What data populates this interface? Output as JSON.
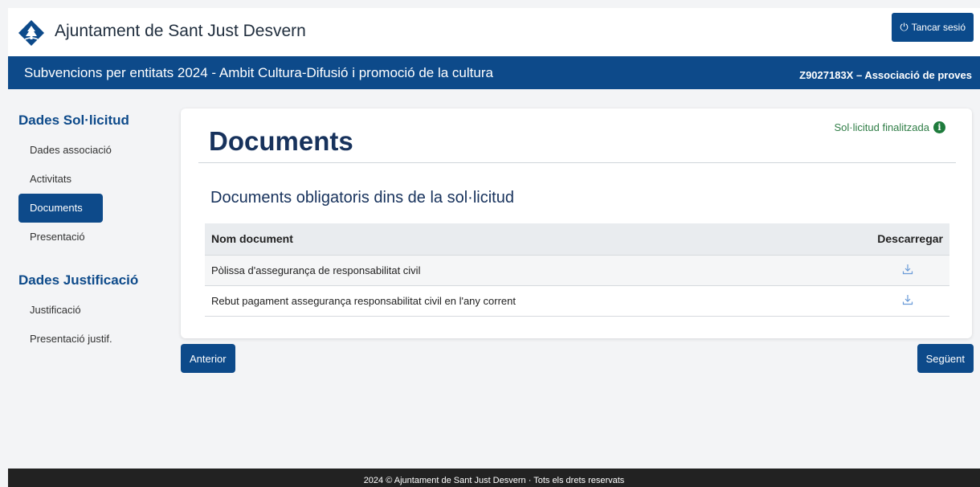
{
  "header": {
    "brand": "Ajuntament de Sant Just Desvern",
    "logout_label": "Tancar sesió"
  },
  "titlebar": {
    "call_title": "Subvencions per entitats 2024 - Ambit Cultura-Difusió i promoció de la cultura",
    "entity": "Z9027183X – Associació de proves"
  },
  "sidebar": {
    "section1": "Dades Sol·licitud",
    "items1": [
      {
        "label": "Dades associació"
      },
      {
        "label": "Activitats"
      },
      {
        "label": "Documents"
      },
      {
        "label": "Presentació"
      }
    ],
    "section2": "Dades Justificació",
    "items2": [
      {
        "label": "Justificació"
      },
      {
        "label": "Presentació justif."
      }
    ]
  },
  "main": {
    "title": "Documents",
    "status": "Sol·licitud finalitzada",
    "status_icon": "info-icon",
    "section_title": "Documents obligatoris dins de la sol·licitud",
    "table": {
      "headers": [
        "Nom document",
        "Descarregar"
      ],
      "rows": [
        {
          "name": "Pòlissa d'assegurança de responsabilitat civil",
          "icon": "download-icon"
        },
        {
          "name": "Rebut pagament assegurança responsabilitat civil en l'any corrent",
          "icon": "download-icon"
        }
      ]
    }
  },
  "nav": {
    "prev_label": "Anterior",
    "next_label": "Següent"
  },
  "footer": {
    "text": "2024 © Ajuntament de Sant Just Desvern · Tots els drets reservats"
  },
  "colors": {
    "primary": "#0d4a8a",
    "status_green": "#2f7d46",
    "download_icon": "#6a9bd8"
  }
}
